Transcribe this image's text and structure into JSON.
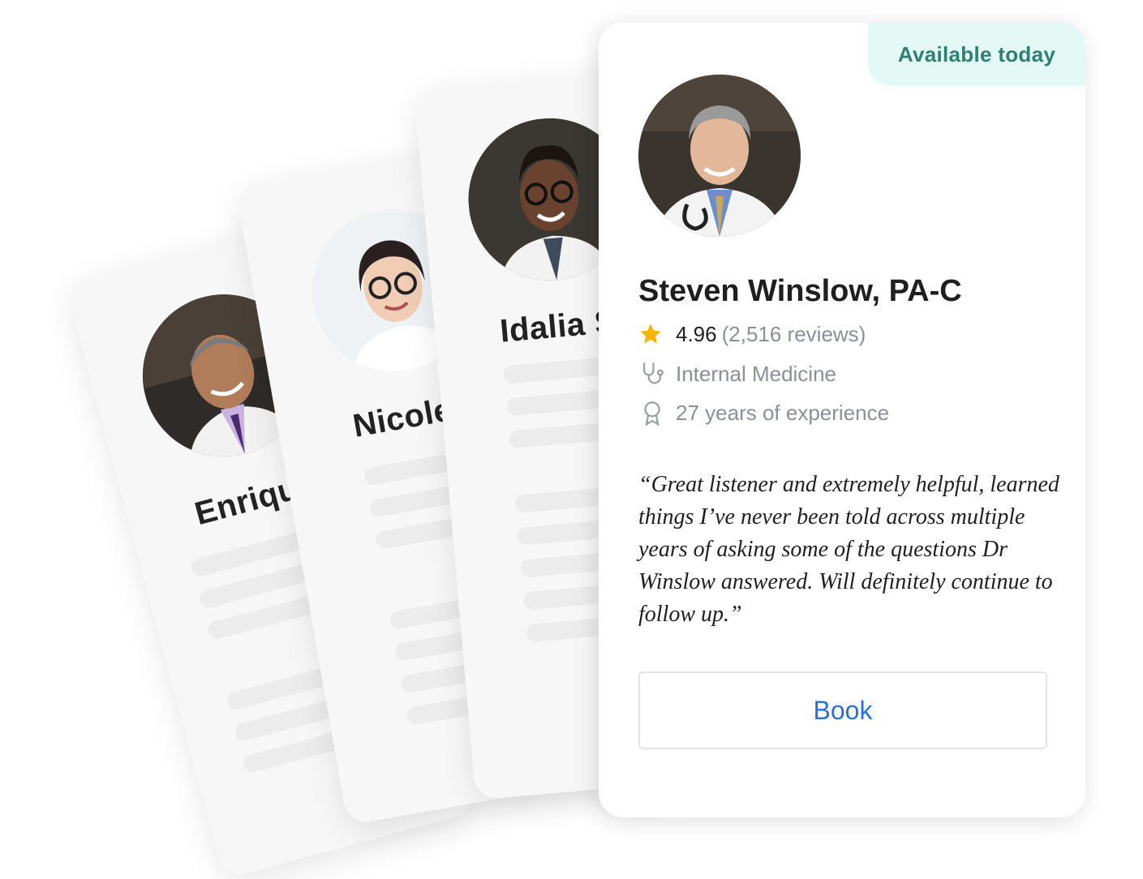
{
  "background_cards": [
    {
      "name": "Enrique"
    },
    {
      "name": "Nicole Ts"
    },
    {
      "name": "Idalia Sa"
    }
  ],
  "main_card": {
    "badge": "Available today",
    "name": "Steven Winslow, PA-C",
    "rating": "4.96",
    "reviews": "(2,516 reviews)",
    "specialty": "Internal Medicine",
    "experience": "27 years of experience",
    "quote": "“Great listener and extremely helpful, learned things I’ve never been told across multiple years of asking some of the questions Dr Winslow answered. Will definitely continue to follow up.”",
    "book_label": "Book"
  },
  "icons": {
    "rating": "star-icon",
    "specialty": "stethoscope-icon",
    "experience": "award-icon"
  },
  "colors": {
    "badge_bg": "#e4f8f5",
    "badge_text": "#2f7f73",
    "star": "#f4b400",
    "book_text": "#2f6fd0"
  }
}
